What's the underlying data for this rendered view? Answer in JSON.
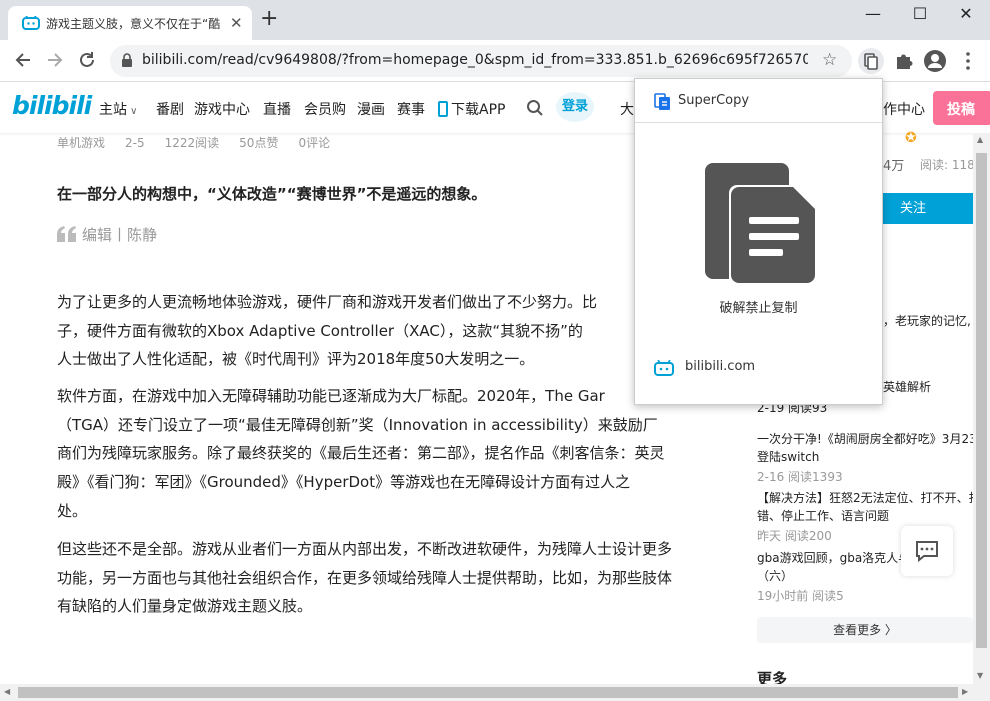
{
  "browser": {
    "tab_title": "游戏主题义肢，意义不仅在于“酷",
    "tab_close": "✕",
    "new_tab": "+",
    "window_min": "—",
    "window_max": "☐",
    "window_close": "✕",
    "url": "bilibili.com/read/cv9649808/?from=homepage_0&spm_id_from=333.851.b_62696c695f7265706f..."
  },
  "site_nav": {
    "logo": "bilibili",
    "items": [
      "主站",
      "番剧",
      "游戏中心",
      "直播",
      "会员购",
      "漫画",
      "赛事"
    ],
    "download_app": "下载APP",
    "login": "登录",
    "partial_left": "大",
    "partial_right": "作中心",
    "publish": "投稿"
  },
  "article": {
    "meta": [
      "单机游戏",
      "2-5",
      "1222阅读",
      "50点赞",
      "0评论"
    ],
    "lead": "在一部分人的构想中，“义体改造”“赛博世界”不是遥远的想象。",
    "author": "编辑丨陈静",
    "paragraphs": [
      "为了让更多的人更流畅地体验游戏，硬件厂商和游戏开发者们做出了不少努力。比",
      "子，硬件方面有微软的Xbox Adaptive Controller（XAC），这款“其貌不扬”的",
      "人士做出了人性化适配，被《时代周刊》评为2018年度50大发明之一。",
      "软件方面，在游戏中加入无障碍辅助功能已逐渐成为大厂标配。2020年，The Gar",
      "（TGA）还专门设立了一项“最佳无障碍创新”奖（Innovation in accessibility）来鼓励厂",
      "商们为残障玩家服务。除了最终获奖的《最后生还者：第二部》，提名作品《刺客信条：英灵",
      "殿》《看门狗：军团》《Grounded》《HyperDot》等游戏也在无障碍设计方面有过人之",
      "处。",
      "但这些还不是全部。游戏从业者们一方面从内部出发，不断改进软硬件，为残障人士设计更多",
      "功能，另一方面也与其他社会组织合作，在更多领域给残障人士提供帮助，比如，为那些肢体",
      "有缺陷的人们量身定做游戏主题义肢。"
    ]
  },
  "sidebar": {
    "stats_fans": "4万",
    "stats_reads": "阅读: 118",
    "follow": "关注",
    "snippet": "，老玩家的记忆,",
    "items": [
      {
        "title": "英雄解析",
        "meta": "2-19 阅读93"
      },
      {
        "title": "一次分干净!《胡闹厨房全都好吃》3月23",
        "title2": "登陆switch",
        "meta": "2-16 阅读1393"
      },
      {
        "title": "【解决方法】狂怒2无法定位、打不开、打",
        "title2": "错、停止工作、语言问题",
        "meta": "昨天 阅读200"
      },
      {
        "title": "gba游戏回顾，gba洛克人与 D覇",
        "title2": "（六）",
        "meta": "19小时前 阅读5"
      }
    ],
    "see_more": "查看更多 〉",
    "section_more": "更多"
  },
  "popup": {
    "title": "SuperCopy",
    "action": "破解禁止复制",
    "host": "bilibili.com"
  },
  "colors": {
    "accent": "#00a1d6",
    "publish": "#fb7299"
  }
}
